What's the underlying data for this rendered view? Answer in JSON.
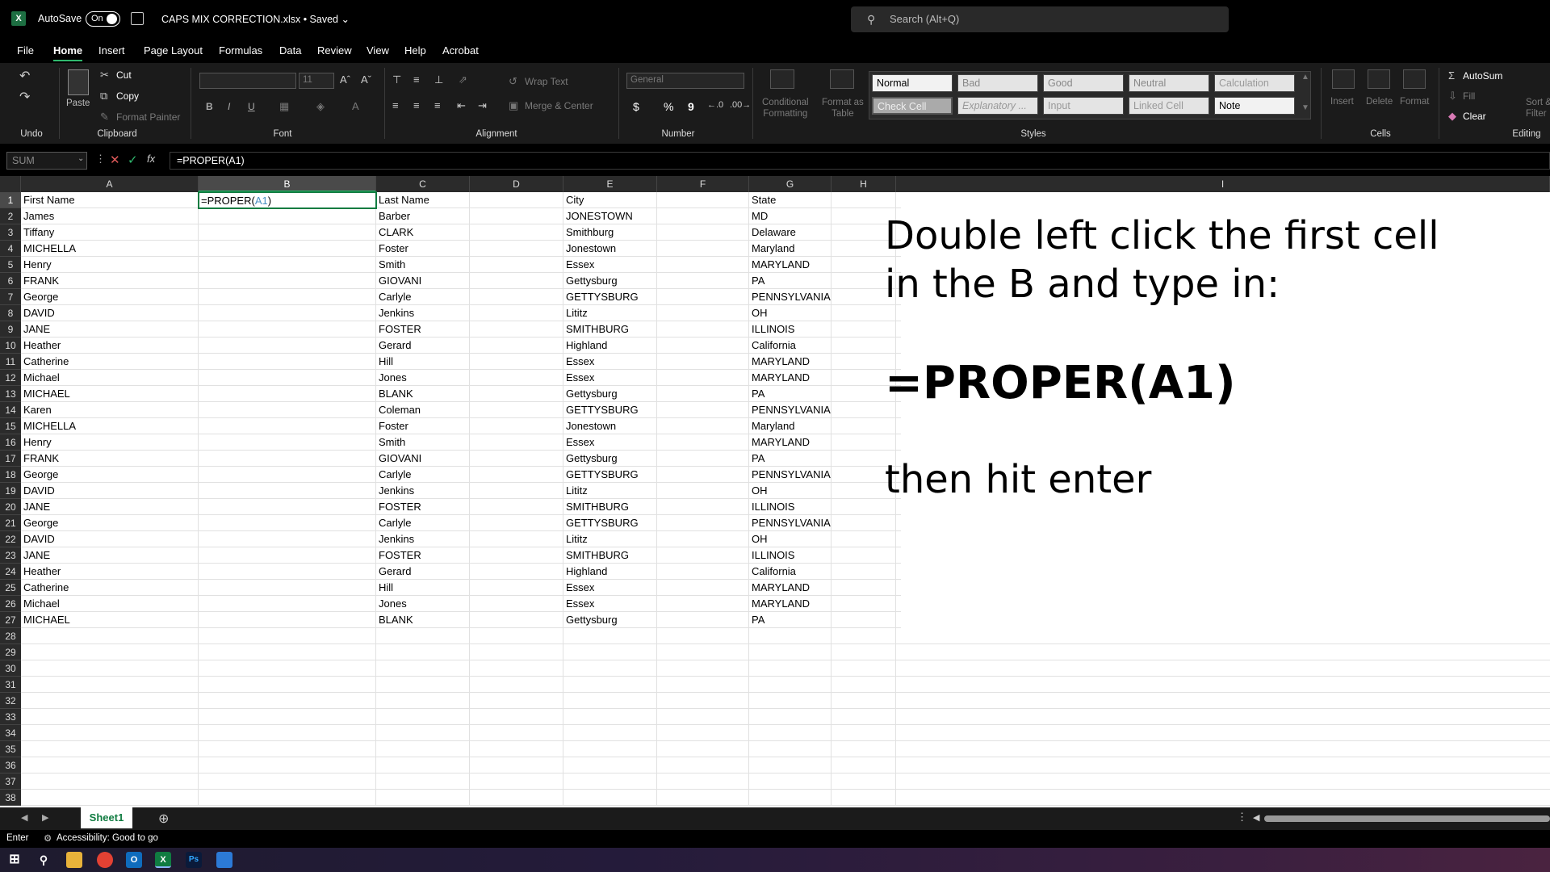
{
  "titlebar": {
    "autosave_label": "AutoSave",
    "toggle_state": "On",
    "filename": "CAPS MIX CORRECTION.xlsx • Saved ⌄",
    "search_placeholder": "Search (Alt+Q)",
    "app_icon": "excel-icon"
  },
  "menu": {
    "tabs": [
      "File",
      "Home",
      "Insert",
      "Page Layout",
      "Formulas",
      "Data",
      "Review",
      "View",
      "Help",
      "Acrobat"
    ],
    "active": "Home"
  },
  "ribbon": {
    "groups": {
      "undo": "Undo",
      "clipboard": "Clipboard",
      "font": "Font",
      "alignment": "Alignment",
      "number": "Number",
      "styles": "Styles",
      "cells": "Cells",
      "editing": "Editing"
    },
    "clipboard": {
      "paste": "Paste",
      "cut": "Cut",
      "copy": "Copy",
      "format_painter": "Format Painter"
    },
    "font": {
      "size": "11",
      "bold": "B",
      "italic": "I",
      "underline": "U"
    },
    "alignment": {
      "wrap_text": "Wrap Text",
      "merge_center": "Merge & Center"
    },
    "number": {
      "format": "General",
      "currency": "$",
      "percent": "%",
      "comma": "9"
    },
    "styles_buttons": {
      "conditional": "Conditional\nFormatting",
      "format_table": "Format as\nTable"
    },
    "style_cells": [
      "Normal",
      "Bad",
      "Good",
      "Neutral",
      "Calculation",
      "Check Cell",
      "Explanatory ...",
      "Input",
      "Linked Cell",
      "Note"
    ],
    "cells": {
      "insert": "Insert",
      "delete": "Delete",
      "format": "Format"
    },
    "editing": {
      "autosum": "AutoSum",
      "fill": "Fill",
      "clear": "Clear",
      "sort": "Sort &\nFilter"
    }
  },
  "formula_bar": {
    "name_box": "SUM",
    "formula": "=PROPER(A1)"
  },
  "grid": {
    "columns": [
      "A",
      "B",
      "C",
      "D",
      "E",
      "F",
      "G",
      "H",
      "I"
    ],
    "selected_column": "B",
    "active_cell_text_prefix": "=PROPER(",
    "active_cell_ref": "A1",
    "active_cell_suffix": ")",
    "rows": [
      [
        "First Name",
        "",
        "Last Name",
        "",
        "City",
        "",
        "State"
      ],
      [
        "James",
        "",
        "Barber",
        "",
        "JONESTOWN",
        "",
        "MD"
      ],
      [
        "Tiffany",
        "",
        "CLARK",
        "",
        "Smithburg",
        "",
        "Delaware"
      ],
      [
        "MICHELLA",
        "",
        "Foster",
        "",
        "Jonestown",
        "",
        "Maryland"
      ],
      [
        "Henry",
        "",
        "Smith",
        "",
        "Essex",
        "",
        "MARYLAND"
      ],
      [
        "FRANK",
        "",
        "GIOVANI",
        "",
        "Gettysburg",
        "",
        "PA"
      ],
      [
        "George",
        "",
        "Carlyle",
        "",
        "GETTYSBURG",
        "",
        "PENNSYLVANIA"
      ],
      [
        "DAVID",
        "",
        "Jenkins",
        "",
        "Lititz",
        "",
        "OH"
      ],
      [
        "JANE",
        "",
        "FOSTER",
        "",
        "SMITHBURG",
        "",
        "ILLINOIS"
      ],
      [
        "Heather",
        "",
        "Gerard",
        "",
        "Highland",
        "",
        "California"
      ],
      [
        "Catherine",
        "",
        "Hill",
        "",
        "Essex",
        "",
        "MARYLAND"
      ],
      [
        "Michael",
        "",
        "Jones",
        "",
        "Essex",
        "",
        "MARYLAND"
      ],
      [
        "MICHAEL",
        "",
        "BLANK",
        "",
        "Gettysburg",
        "",
        "PA"
      ],
      [
        "Karen",
        "",
        "Coleman",
        "",
        "GETTYSBURG",
        "",
        "PENNSYLVANIA"
      ],
      [
        "MICHELLA",
        "",
        "Foster",
        "",
        "Jonestown",
        "",
        "Maryland"
      ],
      [
        "Henry",
        "",
        "Smith",
        "",
        "Essex",
        "",
        "MARYLAND"
      ],
      [
        "FRANK",
        "",
        "GIOVANI",
        "",
        "Gettysburg",
        "",
        "PA"
      ],
      [
        "George",
        "",
        "Carlyle",
        "",
        "GETTYSBURG",
        "",
        "PENNSYLVANIA"
      ],
      [
        "DAVID",
        "",
        "Jenkins",
        "",
        "Lititz",
        "",
        "OH"
      ],
      [
        "JANE",
        "",
        "FOSTER",
        "",
        "SMITHBURG",
        "",
        "ILLINOIS"
      ],
      [
        "George",
        "",
        "Carlyle",
        "",
        "GETTYSBURG",
        "",
        "PENNSYLVANIA"
      ],
      [
        "DAVID",
        "",
        "Jenkins",
        "",
        "Lititz",
        "",
        "OH"
      ],
      [
        "JANE",
        "",
        "FOSTER",
        "",
        "SMITHBURG",
        "",
        "ILLINOIS"
      ],
      [
        "Heather",
        "",
        "Gerard",
        "",
        "Highland",
        "",
        "California"
      ],
      [
        "Catherine",
        "",
        "Hill",
        "",
        "Essex",
        "",
        "MARYLAND"
      ],
      [
        "Michael",
        "",
        "Jones",
        "",
        "Essex",
        "",
        "MARYLAND"
      ],
      [
        "MICHAEL",
        "",
        "BLANK",
        "",
        "Gettysburg",
        "",
        "PA"
      ]
    ],
    "row_count": 38
  },
  "annotation": {
    "line1": "Double left click the first cell",
    "line2": "in the B and type in:",
    "formula": "=PROPER(A1)",
    "line3": "then hit enter"
  },
  "sheets": {
    "active": "Sheet1"
  },
  "status": {
    "mode": "Enter",
    "accessibility": "Accessibility: Good to go"
  },
  "colors": {
    "excel_green": "#107c41",
    "accent_green": "#2fb86e",
    "ref_blue": "#4a90c2"
  }
}
